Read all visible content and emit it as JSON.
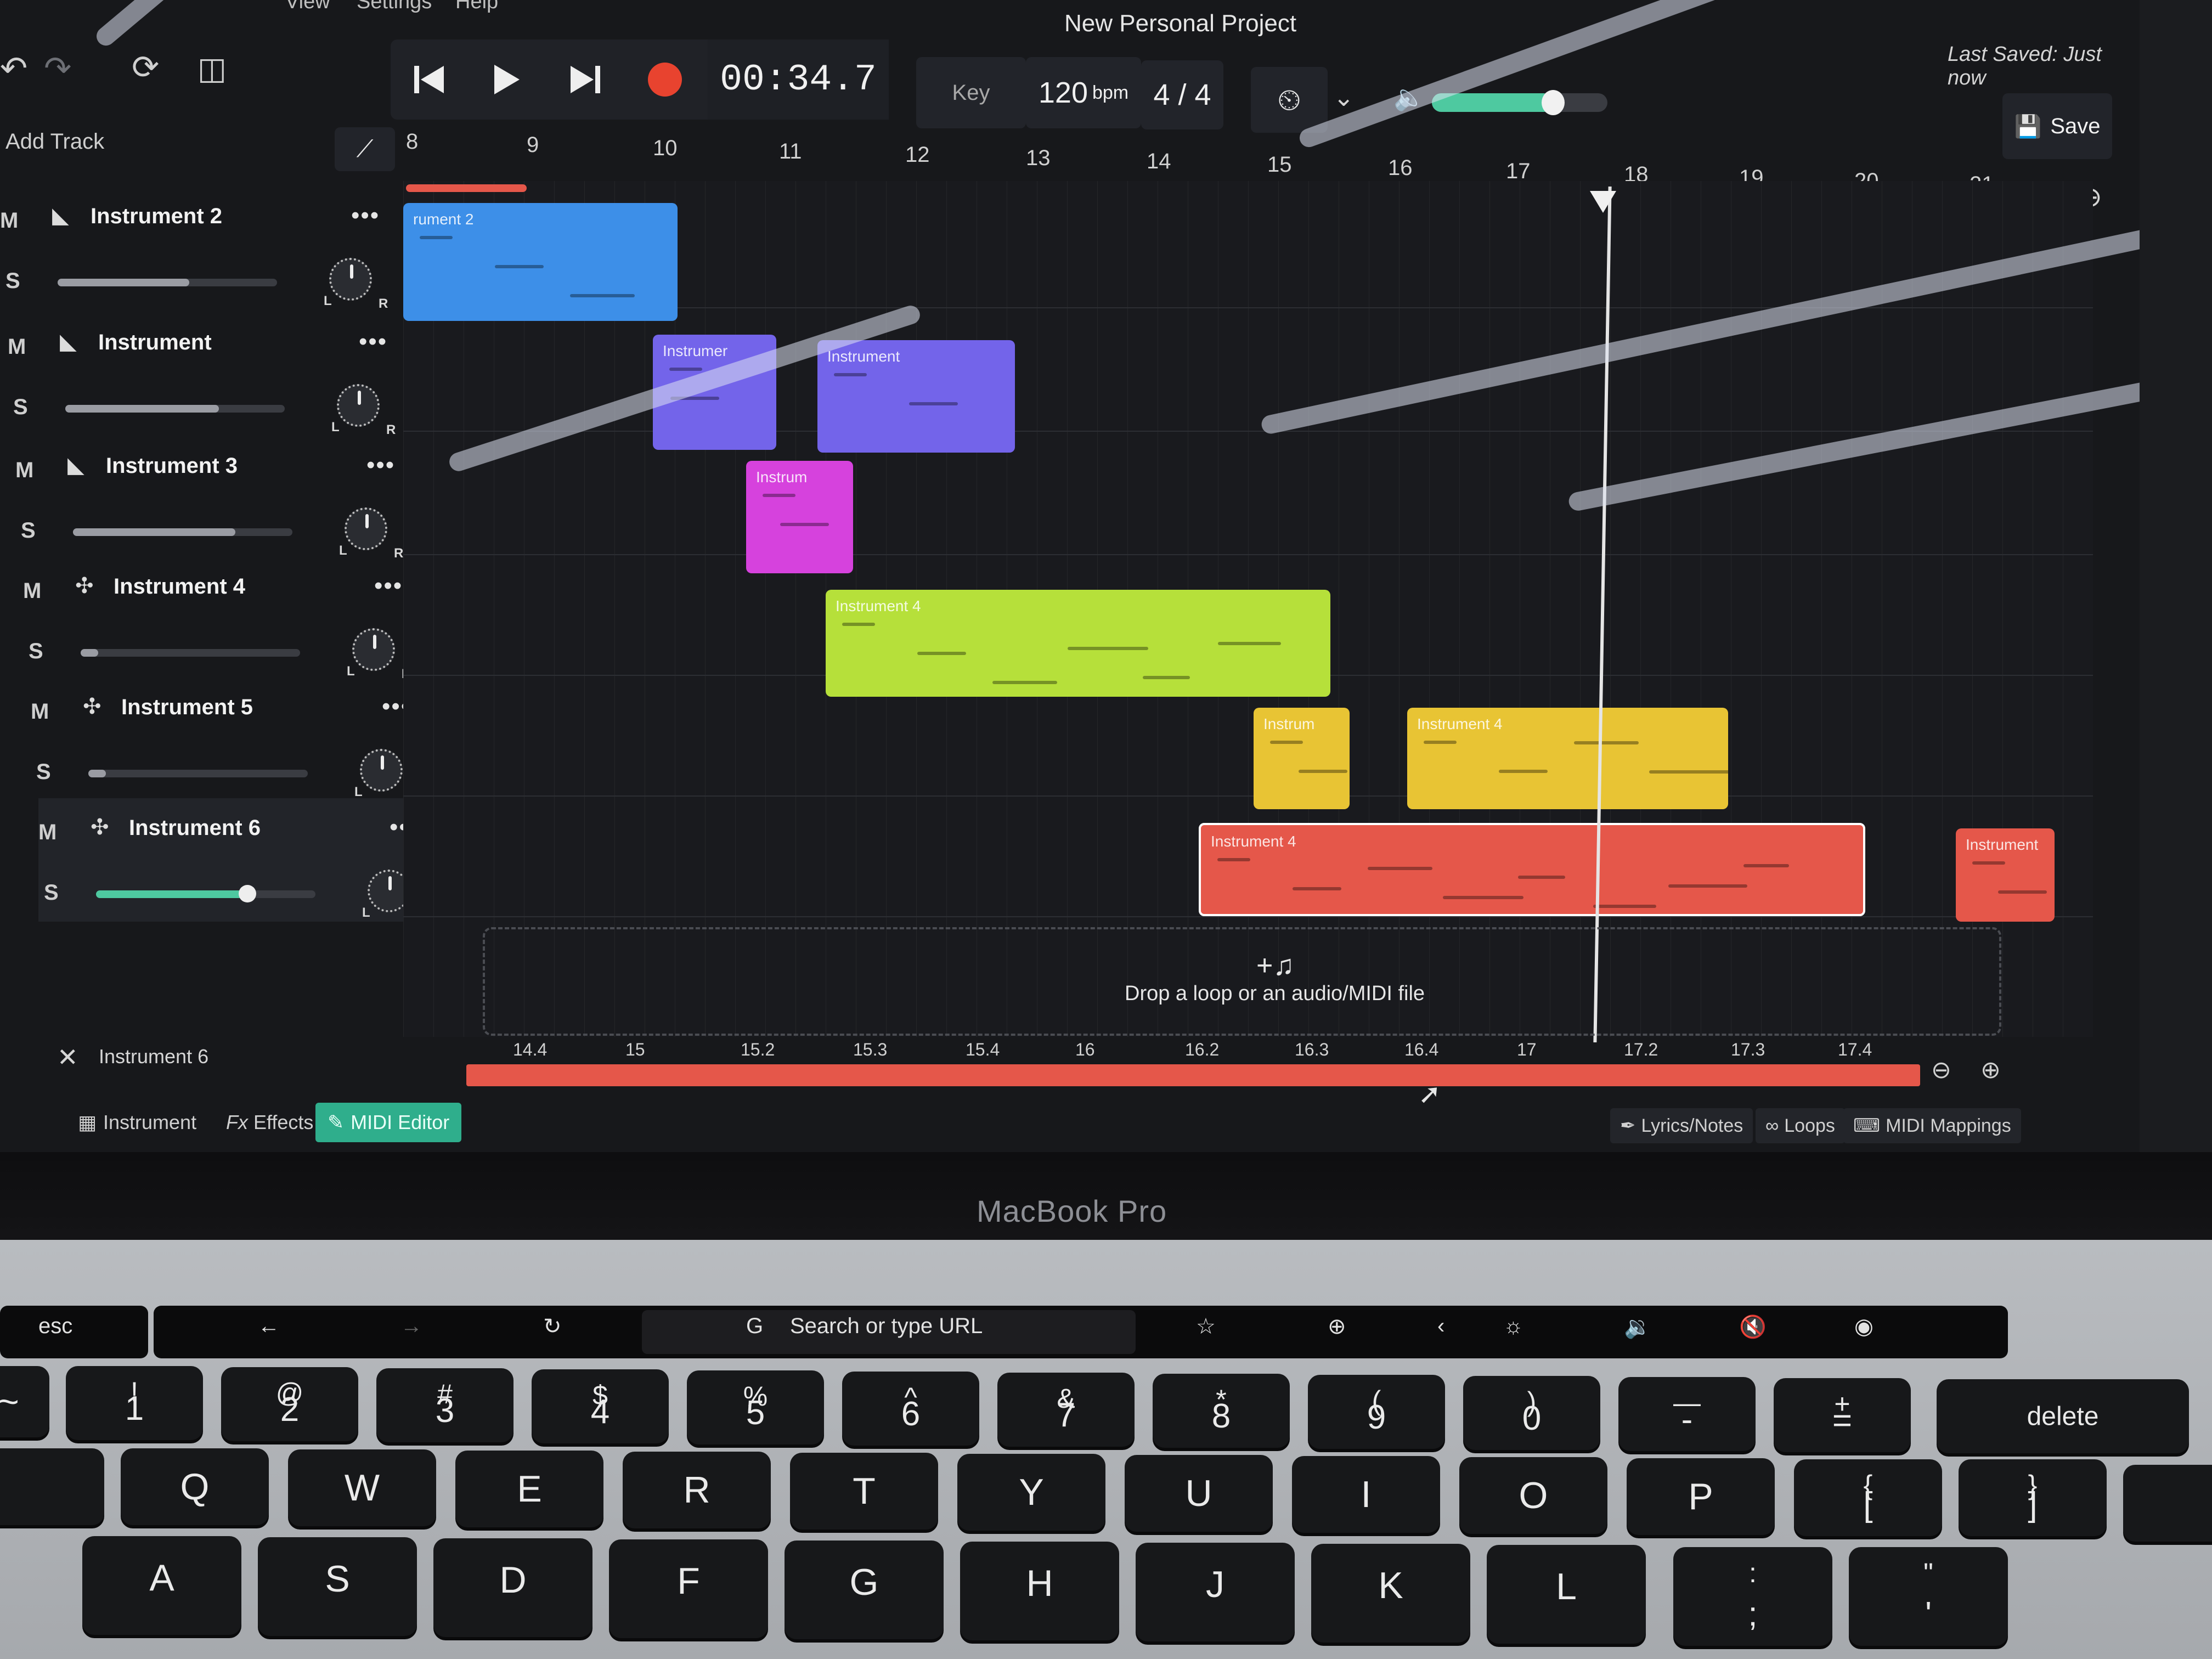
{
  "menu": [
    "View",
    "Settings",
    "Help"
  ],
  "project_title": "New Personal Project",
  "last_saved": "Last Saved: Just now",
  "transport": {
    "time": "00:34.7"
  },
  "key_label": "Key",
  "bpm_value": "120",
  "bpm_unit": "bpm",
  "time_signature": "4 / 4",
  "volume_level": 0.68,
  "save_label": "Save",
  "add_track_label": "Add Track",
  "ruler": [
    "8",
    "9",
    "10",
    "11",
    "12",
    "13",
    "14",
    "15",
    "16",
    "17",
    "18",
    "19",
    "20",
    "21"
  ],
  "tracks": [
    {
      "name": "Instrument 2",
      "m": "M",
      "s": "S",
      "volume": 0.6,
      "icon": "piano-icon"
    },
    {
      "name": "Instrument",
      "m": "M",
      "s": "S",
      "volume": 0.7,
      "icon": "piano-icon"
    },
    {
      "name": "Instrument 3",
      "m": "M",
      "s": "S",
      "volume": 0.74,
      "icon": "piano-icon"
    },
    {
      "name": "Instrument 4",
      "m": "M",
      "s": "S",
      "volume": 0.08,
      "icon": "drum-icon"
    },
    {
      "name": "Instrument 5",
      "m": "M",
      "s": "S",
      "volume": 0.08,
      "icon": "drum-icon"
    },
    {
      "name": "Instrument 6",
      "m": "M",
      "s": "S",
      "volume": 0.68,
      "icon": "drum-icon"
    }
  ],
  "more_label": "•••",
  "knob_left": "L",
  "knob_right": "R",
  "clips": [
    {
      "label": "rument 2",
      "color": "#3d8fe8"
    },
    {
      "label": "Instrumer",
      "color": "#7364ea"
    },
    {
      "label": "Instrument",
      "color": "#7364ea"
    },
    {
      "label": "Instrum",
      "color": "#d642dd"
    },
    {
      "label": "Instrument 4",
      "color": "#b6e03a"
    },
    {
      "label": "Instrum",
      "color": "#e8c434"
    },
    {
      "label": "Instrument 4",
      "color": "#e8c434"
    },
    {
      "label": "Instrument 4",
      "color": "#e5574a"
    },
    {
      "label": "Instrument",
      "color": "#e5574a"
    }
  ],
  "drop_zone_text": "Drop a loop or an audio/MIDI file",
  "drop_zone_icon": "+♫",
  "editor": {
    "title": "Instrument 6",
    "ruler": [
      "14.4",
      "15",
      "15.2",
      "15.3",
      "15.4",
      "16",
      "16.2",
      "16.3",
      "16.4",
      "17",
      "17.2",
      "17.3",
      "17.4"
    ]
  },
  "bottom_tabs": [
    "Instrument",
    "Effects",
    "MIDI Editor"
  ],
  "effects_prefix": "Fx",
  "right_tabs": [
    "Lyrics/Notes",
    "Loops",
    "MIDI Mappings"
  ],
  "laptop_brand": "MacBook Pro",
  "touchbar": {
    "esc": "esc",
    "url_placeholder": "Search or type URL"
  },
  "keys_row1": [
    {
      "top": "!",
      "bot": "1"
    },
    {
      "top": "@",
      "bot": "2"
    },
    {
      "top": "#",
      "bot": "3"
    },
    {
      "top": "$",
      "bot": "4"
    },
    {
      "top": "%",
      "bot": "5"
    },
    {
      "top": "^",
      "bot": "6"
    },
    {
      "top": "&",
      "bot": "7"
    },
    {
      "top": "*",
      "bot": "8"
    },
    {
      "top": "(",
      "bot": "9"
    },
    {
      "top": ")",
      "bot": "0"
    },
    {
      "top": "—",
      "bot": "-"
    },
    {
      "top": "+",
      "bot": "="
    }
  ],
  "key_tilde": "~",
  "key_delete": "delete",
  "keys_row2": [
    "Q",
    "W",
    "E",
    "R",
    "T",
    "Y",
    "U",
    "I",
    "O",
    "P"
  ],
  "keys_row2_brackets": [
    {
      "top": "{",
      "bot": "["
    },
    {
      "top": "}",
      "bot": "]"
    }
  ],
  "keys_row3": [
    "A",
    "S",
    "D",
    "F",
    "G",
    "H",
    "J",
    "K",
    "L"
  ],
  "key_colon": {
    "top": ":",
    "bot": ";"
  },
  "key_quote": {
    "top": "\"",
    "bot": "'"
  },
  "colors": {
    "accent": "#2fae8c",
    "record": "#e8432f",
    "playhead": "#e5e5e5"
  }
}
